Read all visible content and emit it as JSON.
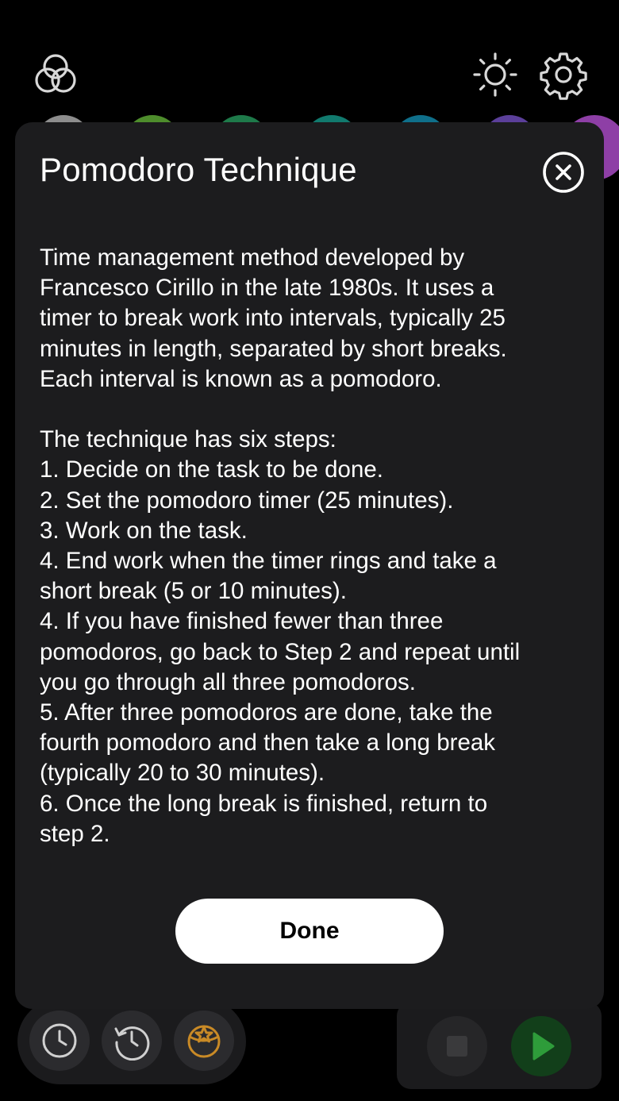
{
  "colors": {
    "background": "#000000",
    "modal_background": "#1c1c1e",
    "text": "#ffffff",
    "done_button_bg": "#ffffff",
    "done_button_text": "#000000",
    "accent_orange": "#c98a26",
    "play_green": "#2e9c3a",
    "swatches": [
      "#8d8d8d",
      "#4e8d2c",
      "#1e7a4a",
      "#117a6e",
      "#0f6f8a",
      "#5b3f9a",
      "#8e3fa6"
    ]
  },
  "header": {
    "left_icon": "rings-icon",
    "right_icons": [
      "sun-icon",
      "gear-icon"
    ]
  },
  "modal": {
    "title": "Pomodoro Technique",
    "close_icon": "close-circle-icon",
    "intro": [
      "Time management method developed by",
      "Francesco Cirillo in the late 1980s. It uses a",
      "timer to break work into intervals, typically 25",
      "minutes in length, separated by short breaks.",
      "Each interval is known as a pomodoro."
    ],
    "steps": [
      "The technique has six steps:",
      "1. Decide on the task to be done.",
      "2. Set the pomodoro timer (25 minutes).",
      "3. Work on the task.",
      "4. End work when the timer rings and take a",
      "short break (5 or 10 minutes).",
      "4. If you have finished fewer than three",
      "pomodoros, go back to Step 2 and repeat until",
      "you go through all three pomodoros.",
      "5. After three pomodoros are done, take the",
      "fourth pomodoro and then take a long break",
      "(typically 20 to 30 minutes).",
      "6. Once the long break is finished, return to",
      "step 2."
    ],
    "done_label": "Done"
  },
  "bottom_bar": {
    "left_icons": [
      "clock-icon",
      "history-icon",
      "badge-icon"
    ],
    "right_icons": [
      "stop-icon",
      "play-icon"
    ]
  }
}
